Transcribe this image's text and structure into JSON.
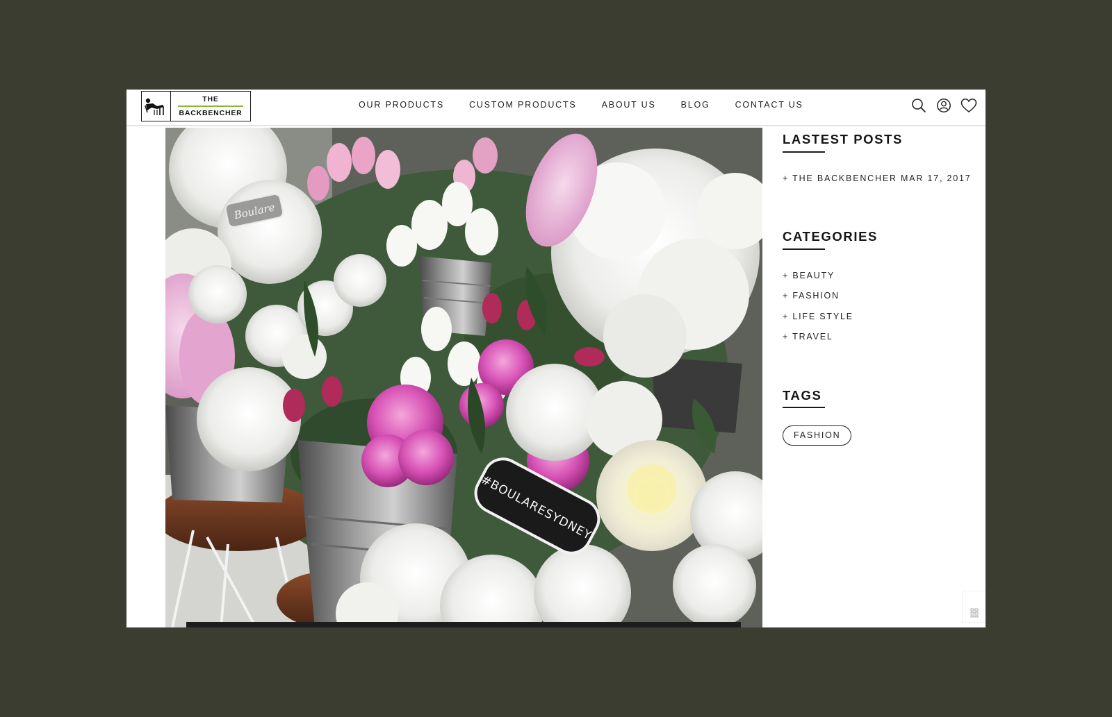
{
  "site": {
    "logo": {
      "line1": "THE",
      "line2": "BACKBENCHER"
    }
  },
  "nav": {
    "items": [
      {
        "label": "OUR PRODUCTS"
      },
      {
        "label": "CUSTOM PRODUCTS"
      },
      {
        "label": "ABOUT US"
      },
      {
        "label": "BLOG"
      },
      {
        "label": "CONTACT US"
      }
    ]
  },
  "header_icons": [
    "search-icon",
    "account-icon",
    "heart-icon"
  ],
  "hero": {
    "chalkboard_text": "#BOULARESYDNEY",
    "sign_text": "Boulare"
  },
  "sidebar": {
    "latest_posts": {
      "title": "LASTEST POSTS",
      "items": [
        {
          "label": "+ THE BACKBENCHER MAR 17, 2017"
        }
      ]
    },
    "categories": {
      "title": "CATEGORIES",
      "items": [
        {
          "label": "+ BEAUTY"
        },
        {
          "label": "+ FASHION"
        },
        {
          "label": "+ LIFE STYLE"
        },
        {
          "label": "+ TRAVEL"
        }
      ]
    },
    "tags": {
      "title": "TAGS",
      "items": [
        {
          "label": "FASHION"
        }
      ]
    }
  },
  "colors": {
    "backdrop": "#3b3d31",
    "logo_accent": "#8ab833",
    "text": "#222222"
  }
}
